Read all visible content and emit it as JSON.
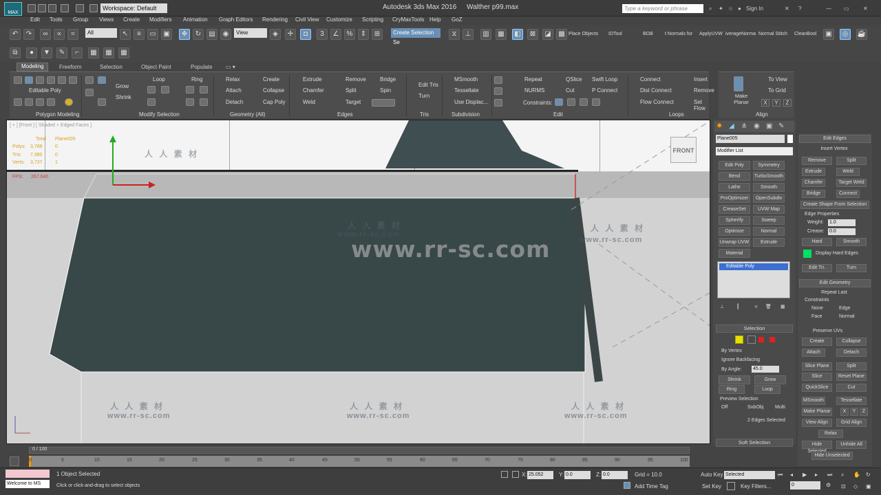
{
  "titlebar": {
    "workspace": "Workspace: Default",
    "app_title": "Autodesk 3ds Max 2016",
    "file_name": "Walther p99.max",
    "search_placeholder": "Type a keyword or phrase",
    "sign_in": "Sign In"
  },
  "menus": [
    "Edit",
    "Tools",
    "Group",
    "Views",
    "Create",
    "Modifiers",
    "Animation",
    "Graph Editors",
    "Rendering",
    "Civil View",
    "Customize",
    "Scripting",
    "CryMaxTools",
    "Help",
    "GoZ"
  ],
  "toolbar": {
    "selection_filter": "All",
    "ref_coord": "View",
    "named_selection": "Create Selection Se",
    "place_objects": "Place Objects",
    "idtool": "IDTool",
    "bob": "BOB",
    "normals_for": "t Normals for",
    "apply_uvw": "ApplyUVW",
    "average_normal": "iverageNorma",
    "normal_stitch": "Normal Stitch",
    "cleanbool": "CleanBool"
  },
  "ribbon": {
    "tabs": [
      "Modeling",
      "Freeform",
      "Selection",
      "Object Paint",
      "Populate"
    ],
    "polygon_modeling": {
      "label": "Editable Poly",
      "footer": "Polygon Modeling"
    },
    "modify_selection": {
      "grow": "Grow",
      "shrink": "Shrink",
      "loop": "Loop",
      "ring": "Ring",
      "footer": "Modify Selection"
    },
    "geometry": {
      "items": [
        "Relax",
        "Create",
        "Attach",
        "Collapse",
        "Detach",
        "Cap Poly"
      ],
      "footer": "Geometry (All)"
    },
    "edges": {
      "items": [
        "Extrude",
        "Remove",
        "Bridge",
        "Chamfer",
        "Split",
        "Spin",
        "Weld",
        "Target"
      ],
      "footer": "Edges"
    },
    "tris": {
      "items": [
        "Edit Tris",
        "Turn"
      ],
      "footer": "Tris"
    },
    "subdivision": {
      "items": [
        "MSmooth",
        "Tessellate",
        "Use Displac..."
      ],
      "footer": "Subdivision"
    },
    "edit": {
      "items": [
        "Repeat",
        "QSlice",
        "Swift Loop",
        "NURMS",
        "Cut",
        "P Connect"
      ],
      "constraints": "Constraints:",
      "footer": "Edit"
    },
    "loops": {
      "items": [
        "Connect",
        "Insert",
        "Dist Connect",
        "Remove",
        "Flow Connect",
        "Set Flow"
      ],
      "footer": "Loops"
    },
    "align": {
      "make_planar": "Make Planar",
      "to_view": "To View",
      "to_grid": "To Grid",
      "x": "X",
      "y": "Y",
      "z": "Z",
      "footer": "Align"
    }
  },
  "viewport": {
    "label": "[ + ] [Front ] [ Shaded + Edged Faces ]",
    "stats": {
      "total": "Total",
      "object": "Plane005",
      "polys_label": "Polys:",
      "polys_total": "3,788",
      "polys_obj": "0",
      "tris_label": "Tris:",
      "tris_total": "7,380",
      "tris_obj": "0",
      "verts_label": "Verts:",
      "verts_total": "3,737",
      "verts_obj": "1"
    },
    "fps_label": "FPS:",
    "fps_value": "267.640",
    "viewcube": "FRONT",
    "watermark_url": "www.rr-sc.com",
    "watermark_cn": "人 人 素 材",
    "watermark_small": "www.rr-sc.com"
  },
  "command_panel": {
    "object_name": "Plane005",
    "modifier_list": "Modifier List",
    "modifier_buttons": [
      "Edit Poly",
      "Symmetry",
      "Bend",
      "TurboSmooth",
      "Lathe",
      "Smooth",
      "ProOptimizer",
      "OpenSubdiv",
      "CreaseSet",
      "UVW Map",
      "Spherify",
      "Sweep",
      "Optimize",
      "Normal",
      "Unwrap UVW",
      "Extrude",
      "Material"
    ],
    "stack_item": "Editable Poly",
    "selection_rollout": "Selection",
    "by_vertex": "By Vertex",
    "ignore_backfacing": "Ignore Backfacing",
    "by_angle": "By Angle:",
    "by_angle_value": "45.0",
    "shrink": "Shrink",
    "grow": "Grow",
    "ring": "Ring",
    "loop": "Loop",
    "preview_selection": "Preview Selection",
    "preview_off": "Off",
    "preview_subobj": "SubObj",
    "preview_multi": "Multi",
    "selected_count": "2 Edges Selected",
    "soft_selection": "Soft Selection"
  },
  "edit_edges": {
    "title": "Edit Edges",
    "insert_vertex": "Insert Vertex",
    "remove": "Remove",
    "split": "Split",
    "extrude": "Extrude",
    "weld": "Weld",
    "chamfer": "Chamfer",
    "target_weld": "Target Weld",
    "bridge": "Bridge",
    "connect": "Connect",
    "create_shape": "Create Shape From Selection",
    "edge_properties": "Edge Properties",
    "weight_label": "Weight:",
    "weight_value": "1.0",
    "crease_label": "Crease:",
    "crease_value": "0.0",
    "hard": "Hard",
    "smooth": "Smooth",
    "display_hard": "Display Hard Edges",
    "edit_tri": "Edit Tri.",
    "turn": "Turn"
  },
  "edit_geometry": {
    "title": "Edit Geometry",
    "repeat_last": "Repeat Last",
    "constraints": "Constraints",
    "none": "None",
    "edge": "Edge",
    "face": "Face",
    "normal": "Normal",
    "preserve_uvs": "Preserve UVs",
    "create": "Create",
    "collapse": "Collapse",
    "attach": "Attach",
    "detach": "Detach",
    "slice_plane": "Slice Plane",
    "split": "Split",
    "slice": "Slice",
    "reset_plane": "Reset Plane",
    "quickslice": "QuickSlice",
    "cut": "Cut",
    "msmooth": "MSmooth",
    "tessellate": "Tessellate",
    "make_planar": "Make Planar",
    "x": "X",
    "y": "Y",
    "z": "Z",
    "view_align": "View Align",
    "grid_align": "Grid Align",
    "relax": "Relax",
    "hide_selected": "Hide Selected",
    "unhide_all": "Unhide All",
    "hide_unselected": "Hide Unselected"
  },
  "timeline": {
    "frame": "0 / 100",
    "ticks": [
      "0",
      "5",
      "10",
      "15",
      "20",
      "25",
      "30",
      "35",
      "40",
      "45",
      "50",
      "55",
      "60",
      "65",
      "70",
      "75",
      "80",
      "85",
      "90",
      "95",
      "100"
    ]
  },
  "status": {
    "listener": "Welcome to MS",
    "selected": "1 Object Selected",
    "prompt": "Click or click-and-drag to select objects",
    "x_label": "X:",
    "x_value": "25.052",
    "y_label": "Y:",
    "y_value": "0.0",
    "z_label": "Z:",
    "z_value": "0.0",
    "grid": "Grid = 10.0",
    "add_time_tag": "Add Time Tag",
    "auto_key": "Auto Key",
    "selected_dropdown": "Selected",
    "set_key": "Set Key",
    "key_filters": "Key Filters...",
    "frame_field": "0"
  },
  "colors": {
    "accent": "#6a8fb5",
    "viewport_bg": "#d2d2d2",
    "mesh": "#354545",
    "selection_yellow": "#e8e000",
    "hard_edge_green": "#00e060"
  }
}
